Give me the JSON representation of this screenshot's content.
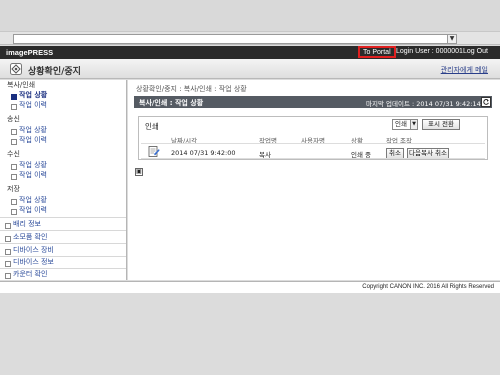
{
  "header": {
    "product_name": "imagePRESS",
    "portal_link": "To Portal",
    "login_info": "Login User : 0000001",
    "logout_link": "Log Out"
  },
  "title_bar": {
    "page_title": "상황확인/중지",
    "admin_link": "관리자에게 메일"
  },
  "sidebar": {
    "sections": [
      {
        "label": "복사/인쇄",
        "items": [
          "작업 상황",
          "작업 이력"
        ]
      },
      {
        "label": "송신",
        "items": [
          "작업 상황",
          "작업 이력"
        ]
      },
      {
        "label": "수신",
        "items": [
          "작업 상황",
          "작업 이력"
        ]
      },
      {
        "label": "저장",
        "items": [
          "작업 상황",
          "작업 이력"
        ]
      }
    ],
    "top_items": [
      "배리 정보",
      "소모품 확인",
      "디바이스 장비",
      "디바이스 정보",
      "카운터 확인"
    ]
  },
  "main": {
    "breadcrumb": "상황확인/중지 : 복사/인쇄 : 작업 상황",
    "section_title": "복사/인쇄 : 작업 상황",
    "last_update": "마지막 업데이트 : 2014 07/31 9:42:14",
    "filter_label": "인쇄",
    "filter_value": "인쇄",
    "display_button": "표시 전환",
    "columns": [
      "날짜/시각",
      "작업명",
      "사용자명",
      "상황",
      "작업 조작"
    ],
    "rows": [
      {
        "datetime": "2014 07/31 9:42:00",
        "job_name": "복사",
        "user_name": "",
        "status": "인쇄 중",
        "actions": [
          "취소",
          "다음복사 취소"
        ]
      }
    ]
  },
  "footer": {
    "copyright": "Copyright CANON INC. 2016 All Rights Reserved"
  },
  "colors": {
    "header_bg": "#2b2b2b",
    "section_bar": "#555b63",
    "portal_highlight": "#e02020",
    "link": "#2a4a9a"
  }
}
